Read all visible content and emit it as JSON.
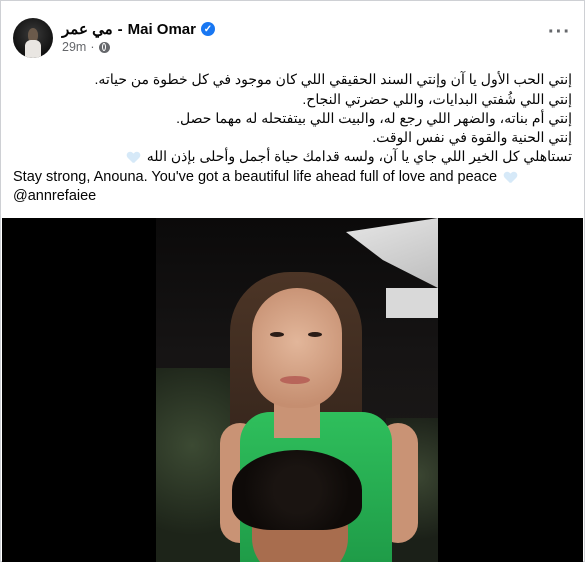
{
  "post": {
    "author_ar": "مي عمر",
    "separator": "-",
    "author_en": "Mai Omar",
    "verified": true,
    "time": "29m",
    "audience_icon": "globe-icon",
    "more_label": "···"
  },
  "body": {
    "ar_lines": [
      "إنتي الحب الأول يا آن وإنتي السند الحقيقي اللي كان موجود في كل خطوة من حياته.",
      "إنتي اللي شُفتي البدايات، واللي حضرتي النجاح.",
      "إنتي أم بناته، والضهر اللي رجع له، والبيت اللي بيتفتحله له مهما حصل.",
      "إنتي الحنية والقوة في نفس الوقت.",
      "تستاهلي كل الخير اللي جاي يا آن، ولسه قدامك حياة أجمل وأحلى بإذن الله"
    ],
    "en_line": "Stay strong, Anouna. You've got a beautiful life ahead full of love and peace",
    "mention": "@annrefaiee"
  },
  "colors": {
    "verified_badge": "#1877f2",
    "meta_text": "#65676b",
    "heart_emoji": "#d6e9f8",
    "top_green": "#2fbf5c"
  }
}
